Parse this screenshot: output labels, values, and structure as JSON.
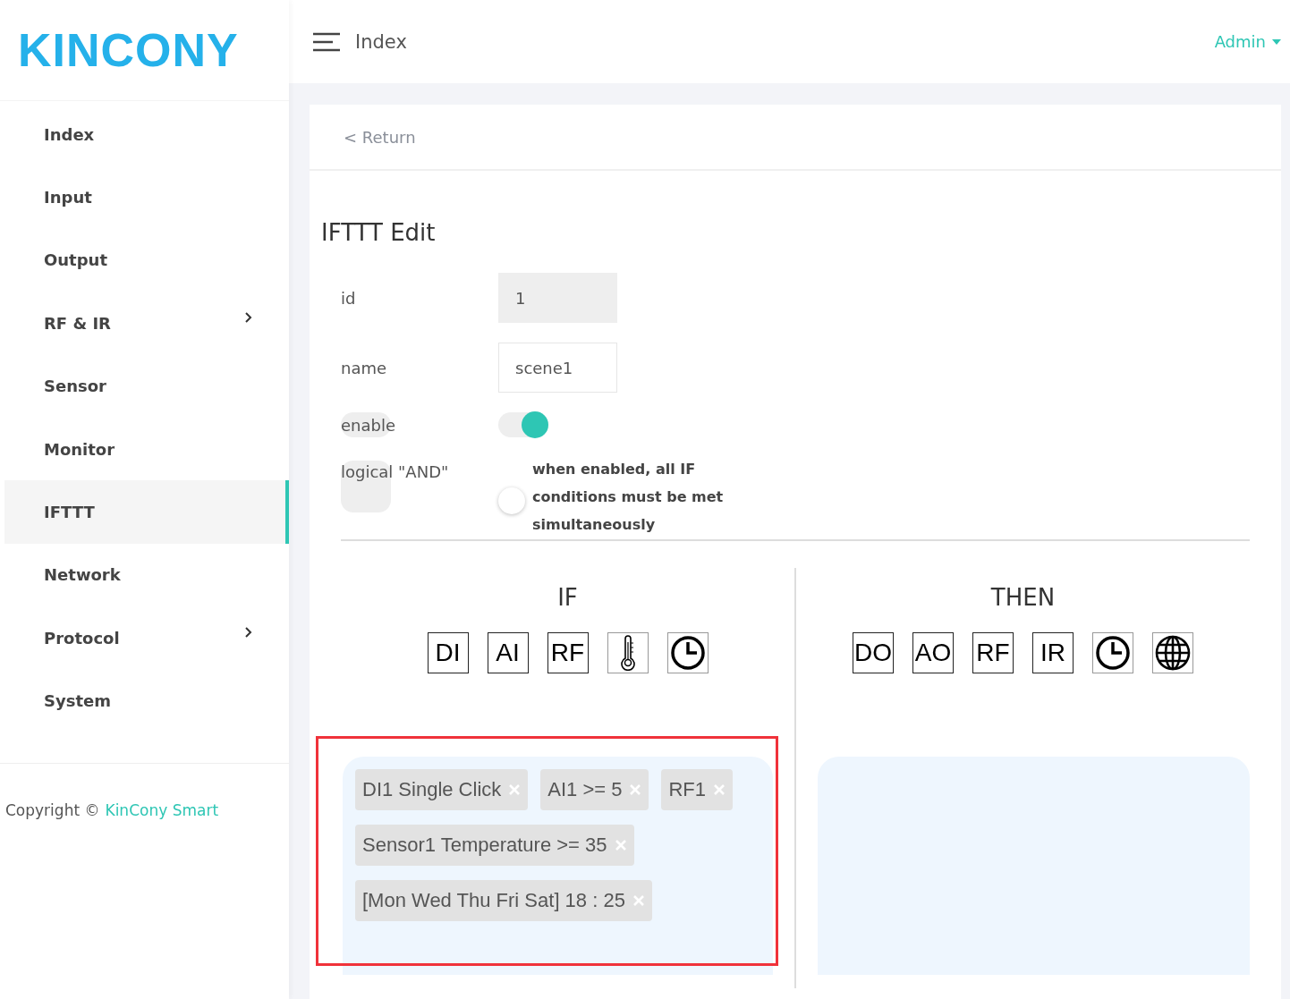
{
  "sidebar": {
    "logo": "KINCONY",
    "items": [
      {
        "label": "Index",
        "selected": false,
        "expandable": false
      },
      {
        "label": "Input",
        "selected": false,
        "expandable": false
      },
      {
        "label": "Output",
        "selected": false,
        "expandable": false
      },
      {
        "label": "RF & IR",
        "selected": false,
        "expandable": true
      },
      {
        "label": "Sensor",
        "selected": false,
        "expandable": false
      },
      {
        "label": "Monitor",
        "selected": false,
        "expandable": false
      },
      {
        "label": "IFTTT",
        "selected": true,
        "expandable": false
      },
      {
        "label": "Network",
        "selected": false,
        "expandable": false
      },
      {
        "label": "Protocol",
        "selected": false,
        "expandable": true
      },
      {
        "label": "System",
        "selected": false,
        "expandable": false
      }
    ],
    "copyright": "Copyright ©",
    "copyright_link": "KinCony Smart"
  },
  "header": {
    "title": "Index",
    "user": "Admin"
  },
  "card": {
    "back": "< Return",
    "title": "IFTTT Edit",
    "fields": [
      {
        "kind": "input",
        "label": "id",
        "value": "1",
        "disabled": true
      },
      {
        "kind": "input",
        "label": "name",
        "value": "scene1",
        "disabled": false
      },
      {
        "kind": "switch",
        "label": "enable",
        "on": true
      },
      {
        "kind": "switch",
        "label": "logical \"AND\"",
        "on": false,
        "note": "when enabled, all IF conditions must be met simultaneously"
      }
    ],
    "if": {
      "heading": "IF",
      "tools": [
        {
          "kind": "text",
          "label": "DI"
        },
        {
          "kind": "text",
          "label": "AI"
        },
        {
          "kind": "text",
          "label": "RF"
        },
        {
          "kind": "thermometer"
        },
        {
          "kind": "clock"
        }
      ],
      "conditions": [
        "DI1 Single Click",
        "AI1 >= 5",
        "RF1",
        "Sensor1 Temperature >= 35",
        "[Mon Wed Thu Fri Sat] 18 : 25"
      ],
      "highlighted": true
    },
    "then": {
      "heading": "THEN",
      "tools": [
        {
          "kind": "text",
          "label": "DO"
        },
        {
          "kind": "text",
          "label": "AO"
        },
        {
          "kind": "text",
          "label": "RF"
        },
        {
          "kind": "text",
          "label": "IR"
        },
        {
          "kind": "clock"
        },
        {
          "kind": "globe"
        }
      ],
      "highlighted": false
    }
  }
}
